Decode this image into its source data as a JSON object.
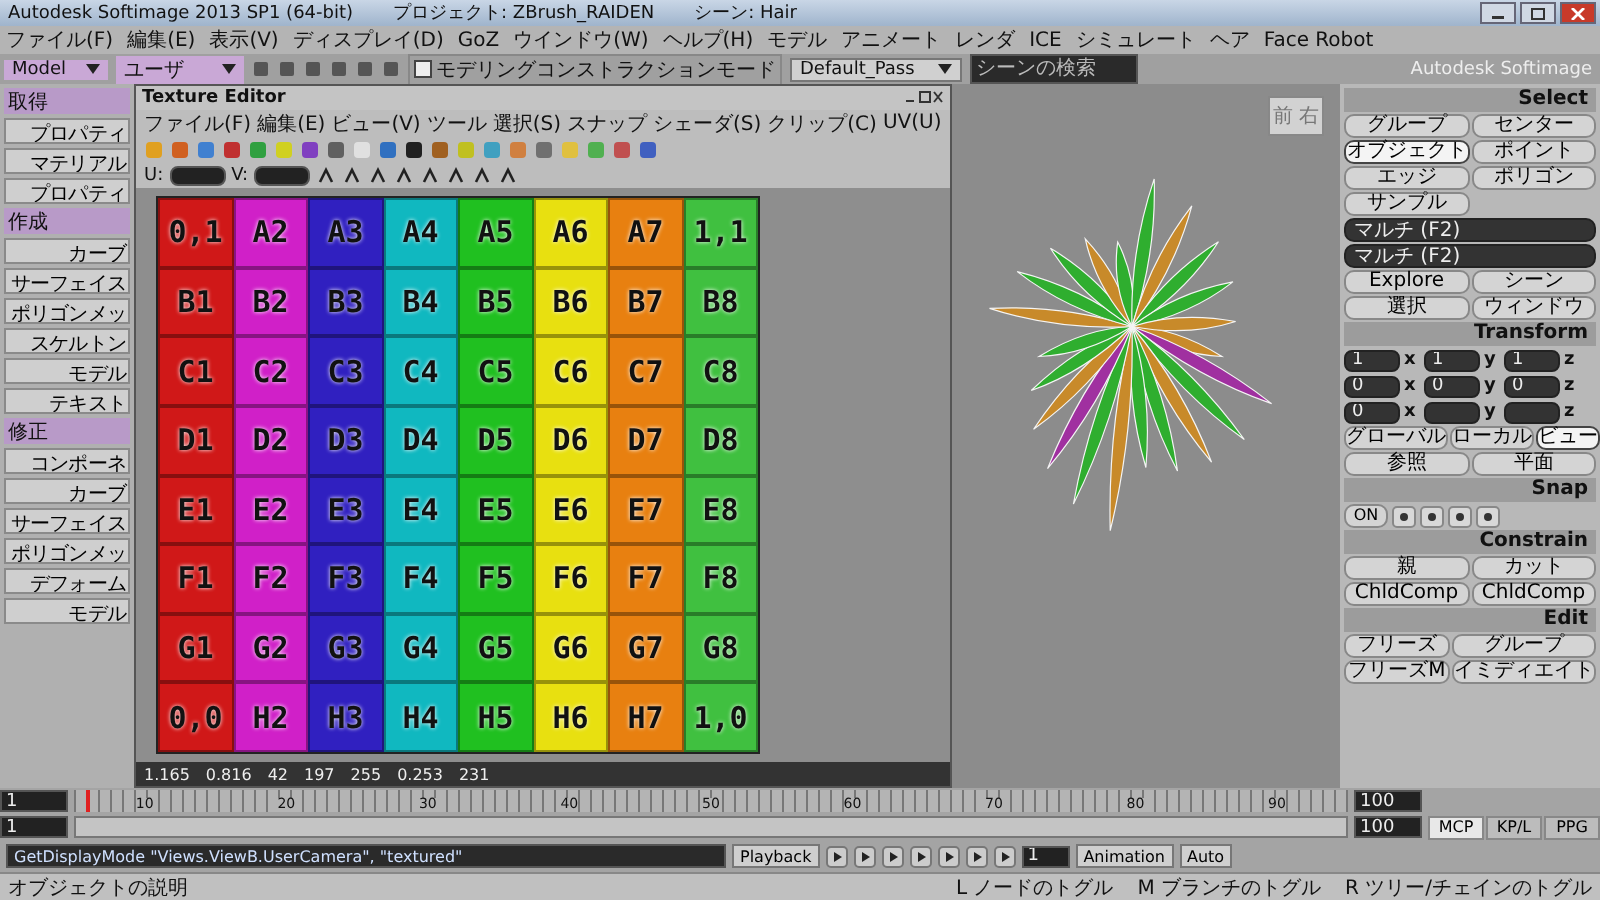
{
  "window": {
    "title": "Autodesk Softimage 2013 SP1 (64-bit)",
    "project": "プロジェクト: ZBrush_RAIDEN",
    "scene": "シーン: Hair"
  },
  "menu_bar": {
    "items": [
      "ファイル(F)",
      "編集(E)",
      "表示(V)",
      "ディスプレイ(D)",
      "GoZ",
      "ウインドウ(W)",
      "ヘルプ(H)",
      "モデル",
      "アニメート",
      "レンダ",
      "ICE",
      "シミュレート",
      "ヘア",
      "Face Robot"
    ],
    "construction_mode": {
      "label": "モデリングコンストラクションモード",
      "checked": false
    },
    "pass": "Default_Pass",
    "search": {
      "placeholder": "シーンの検索"
    },
    "brand": "Autodesk Softimage"
  },
  "toolbar": {
    "layout": "Model",
    "filter": "ユーザ"
  },
  "left_panel": {
    "sections": [
      {
        "title": "取得",
        "items": [
          "プロパティ",
          "マテリアル",
          "プロパティ"
        ]
      },
      {
        "title": "作成",
        "items": [
          "カーブ",
          "サーフェイス",
          "ポリゴンメッ",
          "スケルトン",
          "モデル",
          "テキスト"
        ]
      },
      {
        "title": "修正",
        "items": [
          "コンポーネ",
          "カーブ",
          "サーフェイス",
          "ポリゴンメッ",
          "デフォーム",
          "モデル"
        ]
      }
    ]
  },
  "texture_editor": {
    "title": "Texture Editor",
    "menu": [
      "ファイル(F)",
      "編集(E)",
      "ビュー(V)",
      "ツール",
      "選択(S)",
      "スナップ",
      "シェーダ(S)",
      "クリップ(C)",
      "UV(U)"
    ],
    "u_label": "U:",
    "v_label": "V:",
    "columns": [
      {
        "color": "#d01818"
      },
      {
        "color": "#d020c8"
      },
      {
        "color": "#3020c0"
      },
      {
        "color": "#10b8c0"
      },
      {
        "color": "#20c020"
      },
      {
        "color": "#e8e010"
      },
      {
        "color": "#e88010"
      },
      {
        "color": "#40c040"
      }
    ],
    "rows": [
      [
        "0,1",
        "A2",
        "A3",
        "A4",
        "A5",
        "A6",
        "A7",
        "1,1"
      ],
      [
        "B1",
        "B2",
        "B3",
        "B4",
        "B5",
        "B6",
        "B7",
        "B8"
      ],
      [
        "C1",
        "C2",
        "C3",
        "C4",
        "C5",
        "C6",
        "C7",
        "C8"
      ],
      [
        "D1",
        "D2",
        "D3",
        "D4",
        "D5",
        "D6",
        "D7",
        "D8"
      ],
      [
        "E1",
        "E2",
        "E3",
        "E4",
        "E5",
        "E6",
        "E7",
        "E8"
      ],
      [
        "F1",
        "F2",
        "F3",
        "F4",
        "F5",
        "F6",
        "F7",
        "F8"
      ],
      [
        "G1",
        "G2",
        "G3",
        "G4",
        "G5",
        "G6",
        "G7",
        "G8"
      ],
      [
        "0,0",
        "H2",
        "H3",
        "H4",
        "H5",
        "H6",
        "H7",
        "1,0"
      ]
    ],
    "status": [
      "1.165",
      "0.816",
      "42",
      "197",
      "255",
      "0.253",
      "231"
    ]
  },
  "viewport": {
    "view_cube": [
      "前",
      "右"
    ]
  },
  "right_panel": {
    "select": {
      "title": "Select",
      "buttons": [
        {
          "label": "グループ",
          "selected": false
        },
        {
          "label": "センター",
          "selected": false
        },
        {
          "label": "オブジェクト",
          "selected": true
        },
        {
          "label": "ポイント",
          "selected": false
        },
        {
          "label": "エッジ",
          "selected": false
        },
        {
          "label": "ポリゴン",
          "selected": false
        },
        {
          "label": "サンプル",
          "selected": false
        }
      ],
      "fields": [
        "マルチ (F2)",
        "マルチ (F2)"
      ],
      "buttons2": [
        "Explore",
        "シーン",
        "選択",
        "ウィンドウ"
      ]
    },
    "transform": {
      "title": "Transform",
      "groups": [
        {
          "values": [
            "1",
            "1",
            "1"
          ],
          "axes": [
            "x",
            "y",
            "z"
          ]
        },
        {
          "values": [
            "0",
            "0",
            "0"
          ],
          "axes": [
            "x",
            "y",
            "z"
          ]
        },
        {
          "values": [
            "0"
          ],
          "axes": [
            "x",
            "y",
            "z"
          ]
        }
      ],
      "modes": [
        {
          "label": "グローバル",
          "selected": false
        },
        {
          "label": "ローカル",
          "selected": false
        },
        {
          "label": "ビュー",
          "selected": true
        }
      ],
      "refs": [
        "参照",
        "平面"
      ]
    },
    "snap": {
      "title": "Snap",
      "on": "ON"
    },
    "constrain": {
      "title": "Constrain",
      "buttons": [
        "親",
        "カット",
        "ChldComp",
        "ChldComp"
      ]
    },
    "edit": {
      "title": "Edit",
      "buttons": [
        "フリーズ",
        "グループ",
        "フリーズM",
        "イミディエイト"
      ]
    }
  },
  "timeline": {
    "start": "1",
    "end": "100",
    "range_start": "1",
    "range_end": "100",
    "range": {
      "level": 1
    },
    "ticks": [
      "10",
      "20",
      "30",
      "40",
      "50",
      "60",
      "70",
      "80",
      "90"
    ],
    "current_frame": "1"
  },
  "command": "GetDisplayMode \"Views.ViewB.UserCamera\", \"textured\"",
  "playback": {
    "playback": "Playback",
    "animation": "Animation",
    "auto": "Auto"
  },
  "tabs": [
    {
      "label": "MCP",
      "selected": true
    },
    {
      "label": "KP/L",
      "selected": false
    },
    {
      "label": "PPG",
      "selected": false
    }
  ],
  "status_bar": {
    "description": "オブジェクトの説明",
    "toggles": [
      {
        "key": "L",
        "label": "ノードのトグル"
      },
      {
        "key": "M",
        "label": "ブランチのトグル"
      },
      {
        "key": "R",
        "label": "ツリー/チェインのトグル"
      }
    ]
  }
}
